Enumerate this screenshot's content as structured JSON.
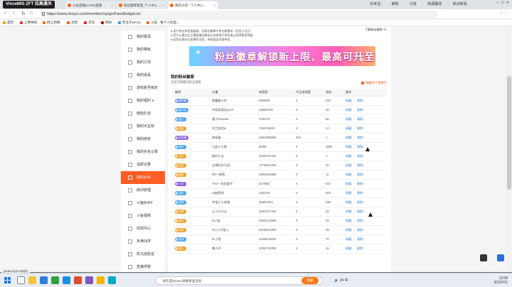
{
  "window": {
    "title_pill": "VinceMIS ZFT 拉高通关"
  },
  "tabs": [
    {
      "label": "斗鱼直播(1/100)直播 ..."
    },
    {
      "label": "粉丝徽章管理_个人中心 ..."
    },
    {
      "label": "我的头衔 - 个人中心 ..."
    }
  ],
  "top_tools": [
    "日米活",
    "审核",
    "分享",
    "跨源翻译",
    "热点新闻"
  ],
  "address": {
    "url": "https://www.douyu.com/member/cp/getFansBadgeList"
  },
  "bookmarks": [
    "首页",
    "上网导航",
    "网上购物",
    "淘宝",
    "京东",
    "网易",
    "专注于win10",
    "斗鱼 - 每个人的直..."
  ],
  "sidebar": {
    "items": [
      {
        "label": "我的邀请"
      },
      {
        "label": "我的等级"
      },
      {
        "label": "我的订阅"
      },
      {
        "label": "我的道具"
      },
      {
        "label": "游戏账号绑定"
      },
      {
        "label": "我的福利 ∨"
      },
      {
        "label": "储值礼包"
      },
      {
        "label": "我的大宝剑"
      },
      {
        "label": "我的房管"
      },
      {
        "label": "我的实名记录"
      },
      {
        "label": "消费记录"
      },
      {
        "label": "我的头衔"
      },
      {
        "label": "房间管理"
      },
      {
        "label": "斗鱼BUFF"
      },
      {
        "label": "斗鱼视频"
      },
      {
        "label": "风险中心"
      },
      {
        "label": "未满18岁"
      },
      {
        "label": "防沉迷验证"
      },
      {
        "label": "直播学院"
      }
    ],
    "active": "我的头衔"
  },
  "notes": {
    "line1": "● 用户粉丝亲密度越高，在粉丝徽章中排名越靠前（仅显示当日）",
    "line2": "● 您可以通过在主播直播间赠送礼物来提升亲密度以获得更高等级",
    "line3": "● 若您长期未在直播间活跃，亲密度会逐渐降低",
    "link": "了解粉丝徽章 >>"
  },
  "banner": {
    "text": "粉丝徽章解锁新上限，最高可升至50级"
  },
  "section": {
    "title": "我的粉丝徽章",
    "subtitle": "当前可佩戴的粉丝徽章",
    "checkbox": "佩戴房下降提示"
  },
  "table": {
    "headers": [
      "徽章",
      "主播",
      "亲密度",
      "今日亲密度",
      "排名",
      "操作"
    ],
    "actions": {
      "wear": "佩戴",
      "delete": "删除"
    },
    "rows": [
      {
        "badge": "紫色徽",
        "color": "#5b8de8",
        "anchor": "紫魔徽小杰",
        "intimacy": "500/900",
        "today": "0",
        "rank": "849"
      },
      {
        "badge": "蓝牙队",
        "color": "#4aa3f0",
        "anchor": "中国英雄吴yeah",
        "intimacy": "4066/6700",
        "today": "0",
        "rank": "49"
      },
      {
        "badge": "蓝心",
        "color": "#4aa3f0",
        "anchor": "猿大Sweetie",
        "intimacy": "379/479",
        "today": "0",
        "rank": "86"
      },
      {
        "badge": "黄金",
        "color": "#f0a030",
        "anchor": "阿兰爱恋ai",
        "intimacy": "7182/28300",
        "today": "0",
        "rank": "12"
      },
      {
        "badge": "星星徽",
        "color": "#8a5be0",
        "anchor": "神秘徽",
        "intimacy": "46510/58800",
        "today": "252",
        "rank": "1"
      },
      {
        "badge": "星空",
        "color": "#4aa3f0",
        "anchor": "王超人小熊",
        "intimacy": "90/90",
        "today": "0",
        "rank": "2680"
      },
      {
        "badge": "金牙",
        "color": "#f0a030",
        "anchor": "娜的小宝",
        "intimacy": "23281/27440",
        "today": "0",
        "rank": "1"
      },
      {
        "badge": "宠家",
        "color": "#f0a030",
        "anchor": "会喝奶的马驹",
        "intimacy": "17738/21000",
        "today": "0",
        "rank": "30"
      },
      {
        "badge": "聚爱",
        "color": "#f0a030",
        "anchor": "PE一稀落",
        "intimacy": "33840/34880",
        "today": "0",
        "rank": "11"
      },
      {
        "badge": "小羊",
        "color": "#8a5be0",
        "anchor": "TAO一老虎鹿子",
        "intimacy": "517/650",
        "today": "0",
        "rank": "847"
      },
      {
        "badge": "蓝色",
        "color": "#4aa3f0",
        "anchor": "16越啊发",
        "intimacy": "132/240",
        "today": "0",
        "rank": "803"
      },
      {
        "badge": "蓝牌",
        "color": "#4aa3f0",
        "anchor": "幸福人小老猫",
        "intimacy": "3638/4240",
        "today": "0",
        "rank": "280"
      },
      {
        "badge": "金牌",
        "color": "#f0a030",
        "anchor": "王小兵Amy",
        "intimacy": "20847/27440",
        "today": "0",
        "rank": "26"
      },
      {
        "badge": "黄金",
        "color": "#f0a030",
        "anchor": "E小道",
        "intimacy": "33251/43060",
        "today": "0",
        "rank": "25"
      },
      {
        "badge": "金狗",
        "color": "#f0a030",
        "anchor": "E小小可爱儿",
        "intimacy": "30186/21000",
        "today": "0",
        "rank": "25"
      },
      {
        "badge": "蓝海",
        "color": "#4aa3f0",
        "anchor": "叶小雪",
        "intimacy": "11459/19000",
        "today": "0",
        "rank": "70"
      },
      {
        "badge": "暖心",
        "color": "#f0a030",
        "anchor": "魏小玲",
        "intimacy": "22357/21000",
        "today": "0",
        "rank": "15"
      }
    ]
  },
  "status_text": "javascript:void(0)",
  "desktop_icons": [
    {
      "label": "互动"
    },
    {
      "label": "钉钉"
    }
  ],
  "taskbar": {
    "search_placeholder": "搜东西(Enter)快捷发送消息",
    "search_button": "搜索",
    "temp": "24",
    "time": "12:08",
    "date": "2023/7/1",
    "ime": "中"
  }
}
